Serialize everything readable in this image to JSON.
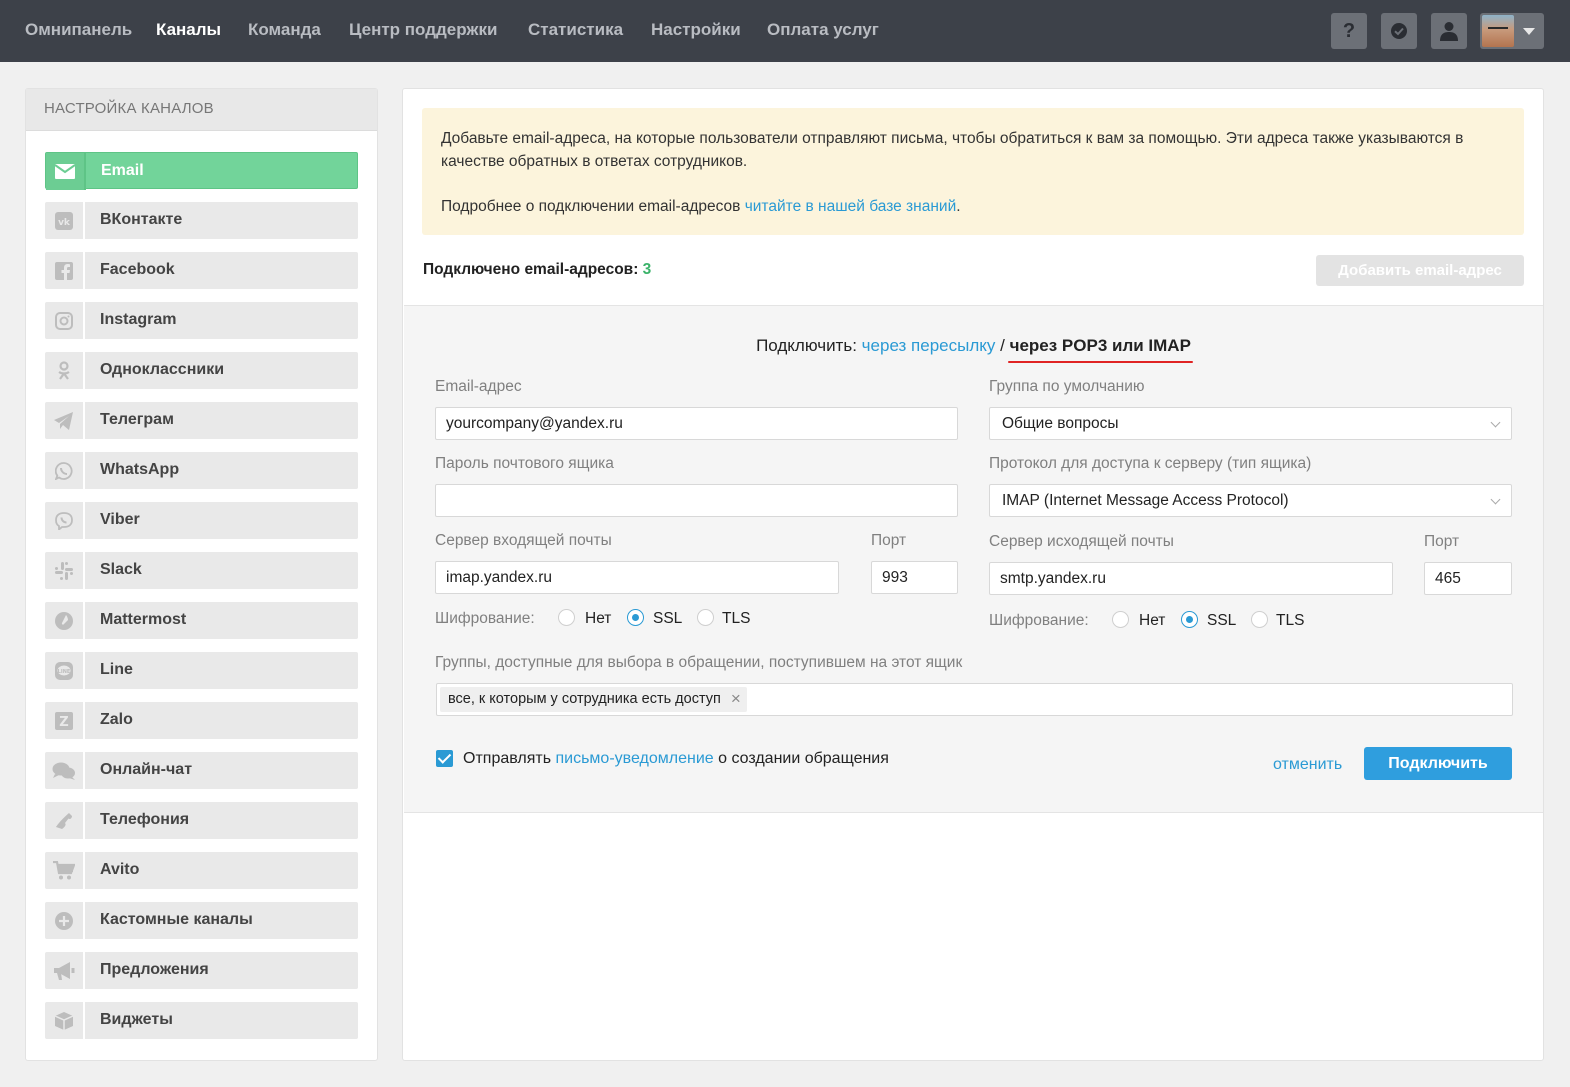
{
  "topnav": {
    "items": [
      "Омнипанель",
      "Каналы",
      "Команда",
      "Центр поддержки",
      "Статистика",
      "Настройки",
      "Оплата услуг"
    ],
    "active_index": 1,
    "icons": [
      "help-icon",
      "badge-check-icon",
      "user-icon",
      "avatar"
    ]
  },
  "sidebar": {
    "title": "НАСТРОЙКА КАНАЛОВ",
    "items": [
      {
        "label": "Email",
        "icon": "envelope-icon",
        "active": true
      },
      {
        "label": "ВКонтакте",
        "icon": "vk-icon"
      },
      {
        "label": "Facebook",
        "icon": "facebook-icon"
      },
      {
        "label": "Instagram",
        "icon": "instagram-icon"
      },
      {
        "label": "Одноклассники",
        "icon": "odnoklassniki-icon"
      },
      {
        "label": "Телеграм",
        "icon": "telegram-icon"
      },
      {
        "label": "WhatsApp",
        "icon": "whatsapp-icon"
      },
      {
        "label": "Viber",
        "icon": "viber-icon"
      },
      {
        "label": "Slack",
        "icon": "slack-icon"
      },
      {
        "label": "Mattermost",
        "icon": "mattermost-icon"
      },
      {
        "label": "Line",
        "icon": "line-icon"
      },
      {
        "label": "Zalo",
        "icon": "zalo-icon"
      },
      {
        "label": "Онлайн-чат",
        "icon": "chat-icon"
      },
      {
        "label": "Телефония",
        "icon": "phone-icon"
      },
      {
        "label": "Avito",
        "icon": "cart-icon"
      },
      {
        "label": "Кастомные каналы",
        "icon": "plus-circle-icon"
      },
      {
        "label": "Предложения",
        "icon": "megaphone-icon"
      },
      {
        "label": "Виджеты",
        "icon": "cube-icon"
      }
    ]
  },
  "info": {
    "line1": "Добавьте email-адреса, на которые пользователи отправляют письма, чтобы обратиться к вам за помощью. Эти адреса также указываются в качестве обратных в ответах сотрудников.",
    "line2_prefix": "Подробнее о подключении email-адресов ",
    "line2_link": "читайте в нашей базе знаний",
    "line2_suffix": "."
  },
  "connected": {
    "label": "Подключено email-адресов:",
    "count": "3"
  },
  "add_button": "Добавить email-адрес",
  "connect": {
    "prefix": "Подключить:",
    "option_forward": "через пересылку",
    "separator": "/",
    "option_imap": "через POP3 или IMAP"
  },
  "form": {
    "email_label": "Email-адрес",
    "email_value": "yourcompany@yandex.ru",
    "password_label": "Пароль почтового ящика",
    "password_value": "",
    "group_label": "Группа по умолчанию",
    "group_value": "Общие вопросы",
    "protocol_label": "Протокол для доступа к серверу (тип ящика)",
    "protocol_value": "IMAP (Internet Message Access Protocol)",
    "in_server_label": "Сервер входящей почты",
    "in_server_value": "imap.yandex.ru",
    "in_port_label": "Порт",
    "in_port_value": "993",
    "out_server_label": "Сервер исходящей почты",
    "out_server_value": "smtp.yandex.ru",
    "out_port_label": "Порт",
    "out_port_value": "465",
    "encryption_label": "Шифрование:",
    "encryption_options": [
      "Нет",
      "SSL",
      "TLS"
    ],
    "in_encryption_selected": "SSL",
    "out_encryption_selected": "SSL",
    "groups_label": "Группы, доступные для выбора в обращении, поступившем на этот ящик",
    "groups_tag": "все, к которым у сотрудника есть доступ",
    "notify_prefix": "Отправлять ",
    "notify_link": "письмо-уведомление",
    "notify_suffix": " о создании обращения",
    "notify_checked": true,
    "cancel": "отменить",
    "submit": "Подключить"
  },
  "colors": {
    "topbar": "#3d4149",
    "active_channel": "#72d49a",
    "link": "#2a9ad4",
    "primary_button": "#2f9ede",
    "info_bg": "#fcf4dc",
    "count": "#3bb36a",
    "underline": "#e02424"
  }
}
